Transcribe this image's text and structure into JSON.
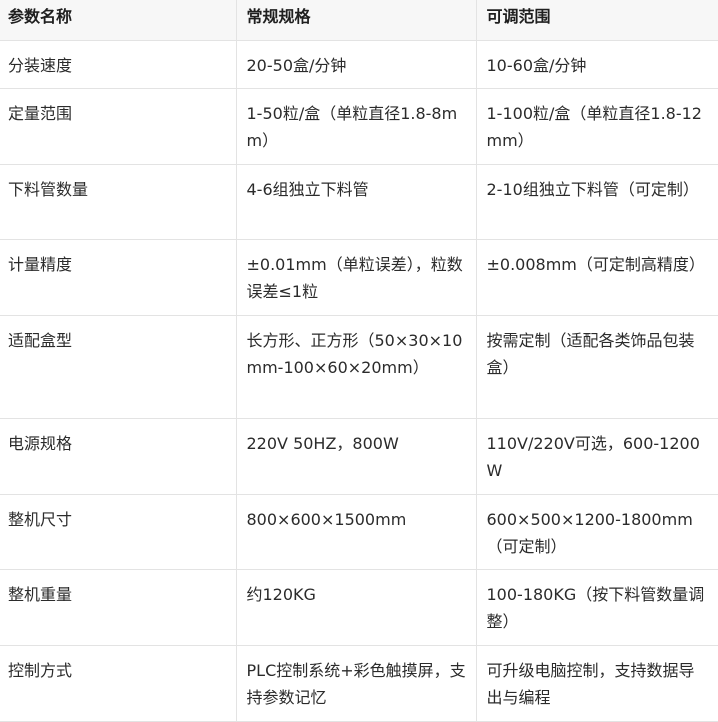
{
  "table": {
    "headers": [
      "参数名称",
      "常规规格",
      "可调范围"
    ],
    "rows": [
      [
        "分装速度",
        "20-50盒/分钟",
        "10-60盒/分钟"
      ],
      [
        "定量范围",
        "1-50粒/盒（单粒直径1.8-8mm）",
        "1-100粒/盒（单粒直径1.8-12mm）"
      ],
      [
        "下料管数量",
        "4-6组独立下料管",
        "2-10组独立下料管（可定制）"
      ],
      [
        "计量精度",
        "±0.01mm（单粒误差），粒数误差≤1粒",
        "±0.008mm（可定制高精度）"
      ],
      [
        "适配盒型",
        "长方形、正方形（50×30×10mm-100×60×20mm）",
        "按需定制（适配各类饰品包装盒）"
      ],
      [
        "电源规格",
        "220V 50HZ，800W",
        "110V/220V可选，600-1200W"
      ],
      [
        "整机尺寸",
        "800×600×1500mm",
        "600×500×1200-1800mm（可定制）"
      ],
      [
        "整机重量",
        "约120KG",
        "100-180KG（按下料管数量调整）"
      ],
      [
        "控制方式",
        "PLC控制系统+彩色触摸屏，支持参数记忆",
        "可升级电脑控制，支持数据导出与编程"
      ]
    ]
  }
}
